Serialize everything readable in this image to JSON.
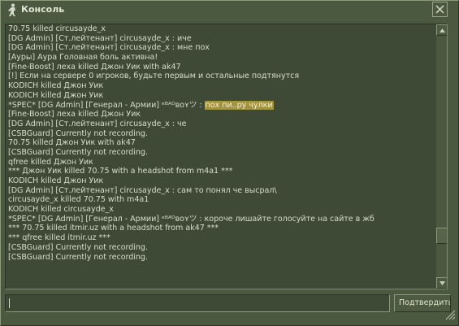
{
  "window": {
    "title": "Консоль",
    "app_icon": "counter-strike-runner-icon",
    "close_icon": "close-x-icon"
  },
  "log": {
    "lines": [
      {
        "text": "70.75 killed circusayde_x"
      },
      {
        "text": "[DG Admin] [Ст.лейтенант] circusayde_x : иче"
      },
      {
        "text": "[DG Admin] [Ст.лейтенант] circusayde_x : мне пох"
      },
      {
        "text": "[Ауры] Аура Головная боль активна!"
      },
      {
        "text": "[Fine-Boost] леха killed Джон Уик with ak47"
      },
      {
        "text": "[!] Если на сервере 0 игроков, будьте первым и остальные подтянутся"
      },
      {
        "text": "KODICH killed Джон Уик"
      },
      {
        "text": "KODICH killed Джон Уик"
      },
      {
        "text": "*SPEC* [DG Admin] [Генерал - Армии] ᵉᴮᴬᴰʙᴏʏツ : ",
        "highlight": "пох пи..ру чулки"
      },
      {
        "text": "[Fine-Boost] леха killed Джон Уик"
      },
      {
        "text": "[DG Admin] [Ст.лейтенант] circusayde_x : че"
      },
      {
        "text": "[CSBGuard] Currently not recording."
      },
      {
        "text": "70.75 killed Джон Уик with ak47"
      },
      {
        "text": "[CSBGuard] Currently not recording."
      },
      {
        "text": "qfree killed Джон Уик"
      },
      {
        "text": "*** Джон Уик killed 70.75 with a headshot from m4a1 ***"
      },
      {
        "text": "KODICH killed Джон Уик"
      },
      {
        "text": "[DG Admin] [Ст.лейтенант] circusayde_x : сам то понял че высрал\\"
      },
      {
        "text": "circusayde_x killed 70.75 with m4a1"
      },
      {
        "text": "KODICH killed circusayde_x"
      },
      {
        "text": "*SPEC* [DG Admin] [Генерал - Армии] ᵉᴮᴬᴰʙᴏʏツ : короче лишайте голосуйте на сайте в жб"
      },
      {
        "text": "*** 70.75 killed itmir.uz with a headshot from ak47 ***"
      },
      {
        "text": "*** qfree killed itmir.uz ***"
      },
      {
        "text": "[CSBGuard] Currently not recording."
      },
      {
        "text": "[CSBGuard] Currently not recording."
      }
    ],
    "highlight_color": "#a3933f"
  },
  "scrollbar": {
    "up_icon": "scroll-up-arrow-icon",
    "down_icon": "scroll-down-arrow-icon"
  },
  "input": {
    "value": "",
    "placeholder": ""
  },
  "submit_label": "Подтвердить",
  "resize_icon": "resize-grip-icon",
  "colors": {
    "background": "#4a5940",
    "panel": "#3e4a36",
    "text": "#d6dccb"
  }
}
